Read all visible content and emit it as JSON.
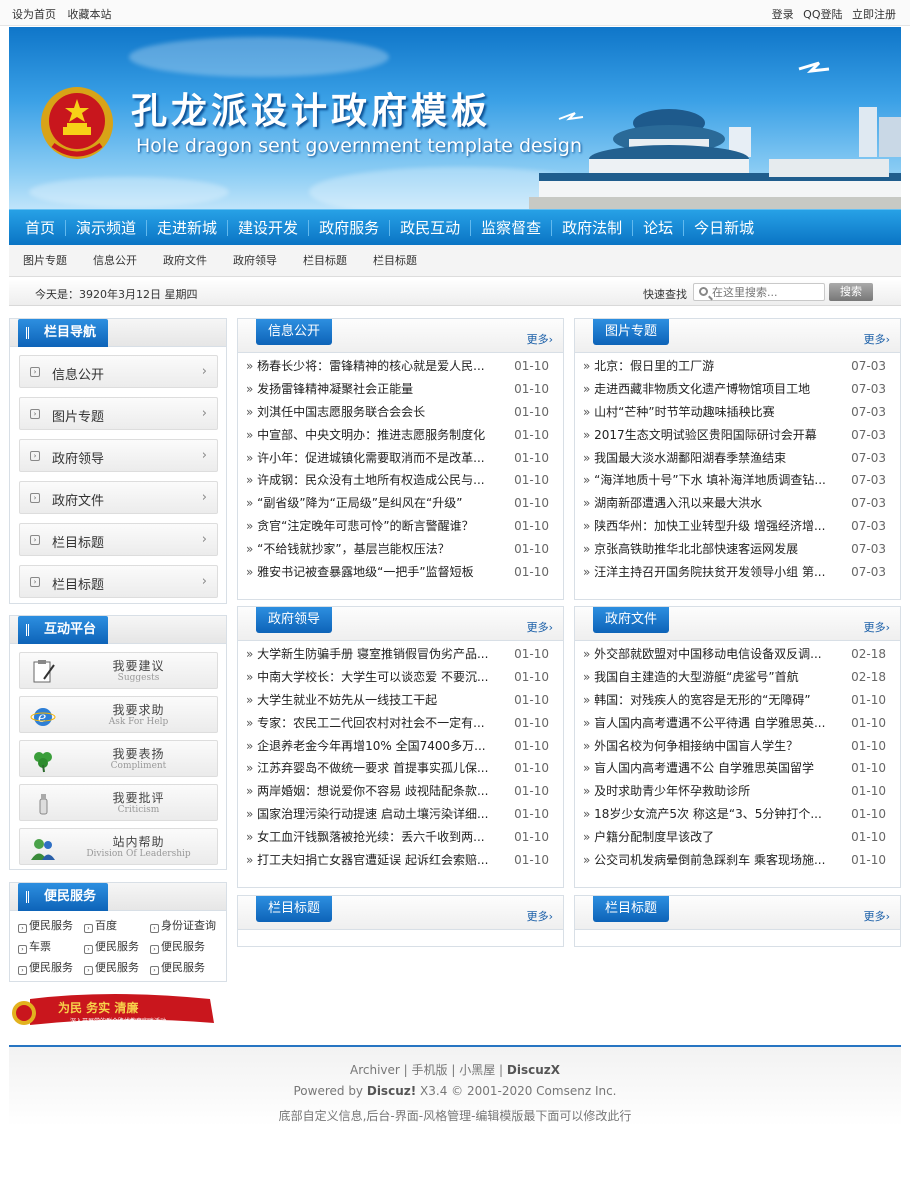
{
  "topbar": {
    "set_home": "设为首页",
    "bookmark": "收藏本站",
    "login": "登录",
    "qq_login": "QQ登陆",
    "register": "立即注册"
  },
  "banner": {
    "title": "孔龙派设计政府模板",
    "subtitle": "Hole dragon sent government template design"
  },
  "main_nav": [
    "首页",
    "演示频道",
    "走进新城",
    "建设开发",
    "政府服务",
    "政民互动",
    "监察督查",
    "政府法制",
    "论坛",
    "今日新城"
  ],
  "sub_nav": [
    "图片专题",
    "信息公开",
    "政府文件",
    "政府领导",
    "栏目标题",
    "栏目标题"
  ],
  "infobar": {
    "date": "今天是：3920年3月12日 星期四",
    "quick_search": "快速查找",
    "search_placeholder": "在这里搜索...",
    "search_button": "搜索"
  },
  "sidebar": {
    "nav_title": "栏目导航",
    "nav_items": [
      "信息公开",
      "图片专题",
      "政府领导",
      "政府文件",
      "栏目标题",
      "栏目标题"
    ],
    "interact_title": "互动平台",
    "interact_items": [
      {
        "cn": "我要建议",
        "en": "Suggests",
        "icon": "clipboard-icon"
      },
      {
        "cn": "我要求助",
        "en": "Ask For Help",
        "icon": "ie-icon"
      },
      {
        "cn": "我要表扬",
        "en": "Compliment",
        "icon": "clover-icon"
      },
      {
        "cn": "我要批评",
        "en": "Criticism",
        "icon": "bottle-icon"
      },
      {
        "cn": "站内帮助",
        "en": "Division Of Leadership",
        "icon": "users-icon"
      }
    ],
    "service_title": "便民服务",
    "service_items": [
      "便民服务",
      "百度",
      "身份证查询",
      "车票",
      "便民服务",
      "便民服务",
      "便民服务",
      "便民服务",
      "便民服务"
    ]
  },
  "panels": [
    {
      "title": "信息公开",
      "more": "更多›",
      "items": [
        {
          "t": "杨春长少将：雷锋精神的核心就是爱人民...",
          "d": "01-10"
        },
        {
          "t": "发扬雷锋精神凝聚社会正能量",
          "d": "01-10"
        },
        {
          "t": "刘淇任中国志愿服务联合会会长",
          "d": "01-10"
        },
        {
          "t": "中宣部、中央文明办：推进志愿服务制度化",
          "d": "01-10"
        },
        {
          "t": "许小年：促进城镇化需要取消而不是改革...",
          "d": "01-10"
        },
        {
          "t": "许成钢：民众没有土地所有权造成公民与...",
          "d": "01-10"
        },
        {
          "t": "“副省级”降为“正局级”是纠风在“升级”",
          "d": "01-10"
        },
        {
          "t": "贪官“注定晚年可悲可怜”的断言警醒谁？",
          "d": "01-10"
        },
        {
          "t": "“不给钱就抄家”，基层岂能权压法？",
          "d": "01-10"
        },
        {
          "t": "雅安书记被查暴露地级“一把手”监督短板",
          "d": "01-10"
        }
      ]
    },
    {
      "title": "图片专题",
      "more": "更多›",
      "items": [
        {
          "t": "北京：假日里的工厂游",
          "d": "07-03"
        },
        {
          "t": "走进西藏非物质文化遗产博物馆项目工地",
          "d": "07-03"
        },
        {
          "t": "山村“芒种”时节竿动趣味插秧比赛",
          "d": "07-03"
        },
        {
          "t": "2017生态文明试验区贵阳国际研讨会开幕",
          "d": "07-03"
        },
        {
          "t": "我国最大淡水湖鄱阳湖春季禁渔结束",
          "d": "07-03"
        },
        {
          "t": "“海洋地质十号”下水 填补海洋地质调查钻...",
          "d": "07-03"
        },
        {
          "t": "湖南新邵遭遇入汛以来最大洪水",
          "d": "07-03"
        },
        {
          "t": "陕西华州：加快工业转型升级 增强经济增...",
          "d": "07-03"
        },
        {
          "t": "京张高铁助推华北北部快速客运网发展",
          "d": "07-03"
        },
        {
          "t": "汪洋主持召开国务院扶贫开发领导小组 第...",
          "d": "07-03"
        }
      ]
    },
    {
      "title": "政府领导",
      "more": "更多›",
      "items": [
        {
          "t": "大学新生防骗手册 寝室推销假冒伪劣产品...",
          "d": "01-10"
        },
        {
          "t": "中南大学校长：大学生可以谈恋爱 不要沉...",
          "d": "01-10"
        },
        {
          "t": "大学生就业不妨先从一线技工干起",
          "d": "01-10"
        },
        {
          "t": "专家：农民工二代回农村对社会不一定有...",
          "d": "01-10"
        },
        {
          "t": "企退养老金今年再增10% 全国7400多万...",
          "d": "01-10"
        },
        {
          "t": "江苏弃婴岛不做统一要求 首提事实孤儿保...",
          "d": "01-10"
        },
        {
          "t": "两岸婚姻：想说爱你不容易 歧视陆配条款...",
          "d": "01-10"
        },
        {
          "t": "国家治理污染行动提速 启动土壤污染详细...",
          "d": "01-10"
        },
        {
          "t": "女工血汗钱飘落被抢光续：丢六千收到两...",
          "d": "01-10"
        },
        {
          "t": "打工夫妇捐亡女器官遭延误 起诉红会索赔...",
          "d": "01-10"
        }
      ]
    },
    {
      "title": "政府文件",
      "more": "更多›",
      "items": [
        {
          "t": "外交部就欧盟对中国移动电信设备双反调...",
          "d": "02-18"
        },
        {
          "t": "我国自主建造的大型游艇“虎鲨号”首航",
          "d": "02-18"
        },
        {
          "t": "韩国：对残疾人的宽容是无形的“无障碍”",
          "d": "01-10"
        },
        {
          "t": "盲人国内高考遭遇不公平待遇 自学雅思英...",
          "d": "01-10"
        },
        {
          "t": "外国名校为何争相接纳中国盲人学生？",
          "d": "01-10"
        },
        {
          "t": "盲人国内高考遭遇不公 自学雅思英国留学",
          "d": "01-10"
        },
        {
          "t": "及时求助青少年怀孕救助诊所",
          "d": "01-10"
        },
        {
          "t": "18岁少女流产5次 称这是“3、5分钟打个...",
          "d": "01-10"
        },
        {
          "t": "户籍分配制度早该改了",
          "d": "01-10"
        },
        {
          "t": "公交司机发病晕倒前急踩刹车 乘客现场施...",
          "d": "01-10"
        }
      ]
    },
    {
      "title": "栏目标题",
      "more": "更多›",
      "items": []
    },
    {
      "title": "栏目标题",
      "more": "更多›",
      "items": []
    }
  ],
  "ribbon": {
    "text": "为民 务实 清廉",
    "small": "深入开展党的群众路线教育实践活动"
  },
  "footer": {
    "links": [
      "Archiver",
      "手机版",
      "小黑屋",
      "DiscuzX"
    ],
    "powered_prefix": "Powered by ",
    "powered_brand": "Discuz!",
    "powered_rest": " X3.4 © 2001-2020 Comsenz Inc.",
    "custom": "底部自定义信息,后台-界面-风格管理-编辑模版最下面可以修改此行"
  },
  "colors": {
    "accent": "#0d6fc4",
    "nav": "#1189d8",
    "footer_rule": "#2775c2"
  }
}
